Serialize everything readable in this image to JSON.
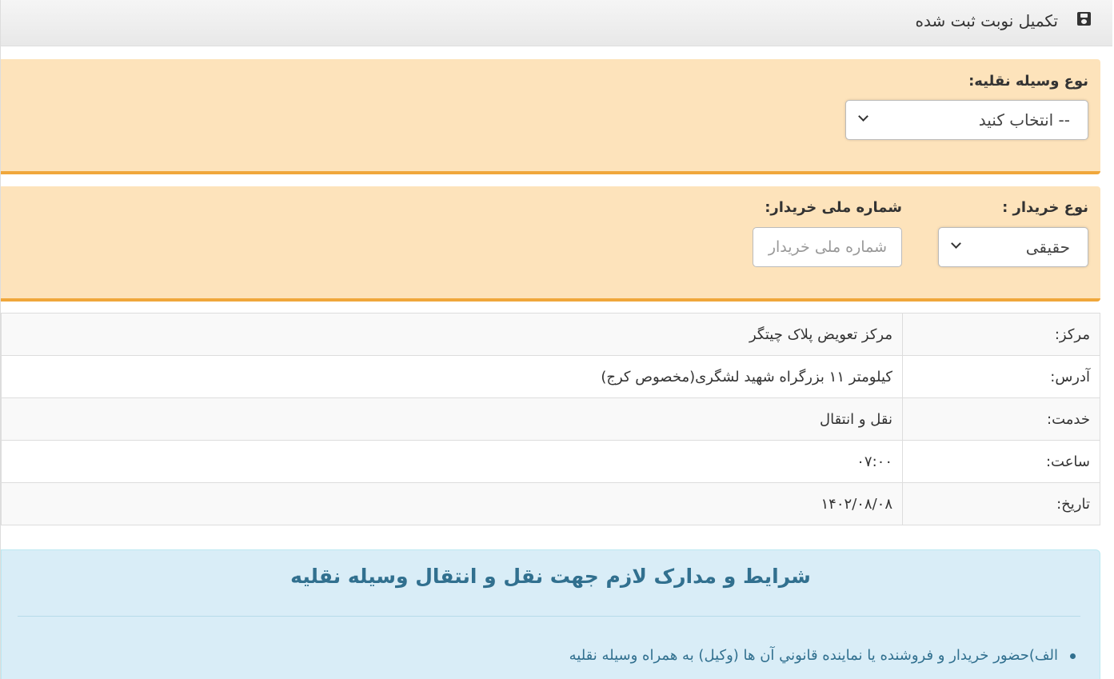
{
  "header": {
    "icon": "save-icon",
    "title": "تکمیل نوبت ثبت شده"
  },
  "vehicle": {
    "label": "نوع وسیله نقلیه:",
    "selected": "-- انتخاب کنید"
  },
  "buyer": {
    "type_label": "نوع خریدار :",
    "type_selected": "حقیقی",
    "national_id_label": "شماره ملی خریدار:",
    "national_id_placeholder": "شماره ملی خریدار",
    "national_id_value": ""
  },
  "details": {
    "rows": [
      {
        "key": "مرکز:",
        "value": "مرکز تعویض پلاک چیتگر"
      },
      {
        "key": "آدرس:",
        "value": "کیلومتر ۱۱ بزرگراه شهید لشگری(مخصوص کرج)"
      },
      {
        "key": "خدمت:",
        "value": "نقل و انتقال"
      },
      {
        "key": "ساعت:",
        "value": "۰۷:۰۰"
      },
      {
        "key": "تاریخ:",
        "value": "۱۴۰۲/۰۸/۰۸"
      }
    ]
  },
  "requirements": {
    "title": "شرایط و مدارک لازم جهت نقل و انتقال وسیله نقلیه",
    "items": [
      "الف)حضور خريدار و فروشنده يا نماينده قانوني آن ها (وكيل) به همراه وسيله نقليه"
    ]
  },
  "colors": {
    "warning_bg": "#fde3bb",
    "warning_border": "#f0a73b",
    "info_bg": "#d9edf7",
    "info_text": "#31708f"
  }
}
